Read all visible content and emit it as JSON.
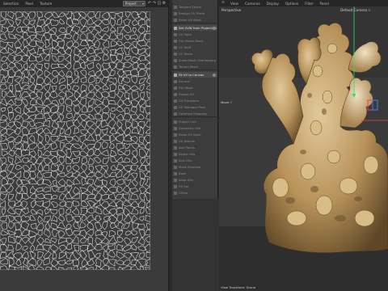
{
  "uv_editor": {
    "menu": [
      "Selection",
      "Pixel",
      "Texture"
    ],
    "project_select": "Project",
    "toolbar_icons": [
      "undo-icon",
      "redo-icon",
      "fit-icon",
      "settings-icon"
    ]
  },
  "object_manager": {
    "rows": [
      {
        "label": "Tangent Space",
        "active": false
      },
      {
        "label": "Realign UV Plane",
        "active": false
      },
      {
        "label": "Relax UV Mesh",
        "active": false
      },
      {
        "label": "Set UVW from Projection",
        "active": true
      },
      {
        "label": "UV Paint",
        "active": false
      },
      {
        "label": "Flip Frame Back",
        "active": false
      },
      {
        "label": "UV Shift",
        "active": false
      },
      {
        "label": "UV Mirror",
        "active": false
      },
      {
        "label": "Show Mesh Overlapping",
        "active": false
      },
      {
        "label": "Terrain Mask",
        "active": false
      },
      {
        "label": "Fit UV to Canvas",
        "active": true
      },
      {
        "label": "Normal",
        "active": false
      },
      {
        "label": "Flip Mask",
        "active": false
      },
      {
        "label": "Rotate UV",
        "active": false
      },
      {
        "label": "UV Transform",
        "active": false
      },
      {
        "label": "UV Manager Pack",
        "active": false
      },
      {
        "label": "Optimize Mapping",
        "active": false
      },
      {
        "label": "Project UVs",
        "active": false
      },
      {
        "label": "Geometry UVs",
        "active": false
      },
      {
        "label": "Relax UV Bake",
        "active": false
      },
      {
        "label": "UV Islands",
        "active": false
      },
      {
        "label": "Add Points",
        "active": false
      },
      {
        "label": "Select UVs",
        "active": false
      },
      {
        "label": "Sort UVs",
        "active": false
      },
      {
        "label": "Mask Selected",
        "active": false
      },
      {
        "label": "Bake",
        "active": false
      },
      {
        "label": "Keep UVs",
        "active": false
      },
      {
        "label": "Fill Sel",
        "active": false
      },
      {
        "label": "Offset",
        "active": false
      }
    ]
  },
  "viewport": {
    "menu": [
      "View",
      "Cameras",
      "Display",
      "Options",
      "Filter",
      "Panel"
    ],
    "view_label": "Perspective",
    "camera_label": "Default Camera ⁝⁝",
    "tool_label": "Move ⁝⁝",
    "status_label": "View Transform: Scene",
    "colors": {
      "y_axis": "#2ee06a",
      "x_axis": "#e8424a",
      "z_axis": "#3c7cff",
      "model_base": "#c9a56a",
      "model_shadow": "#6e5630"
    }
  }
}
